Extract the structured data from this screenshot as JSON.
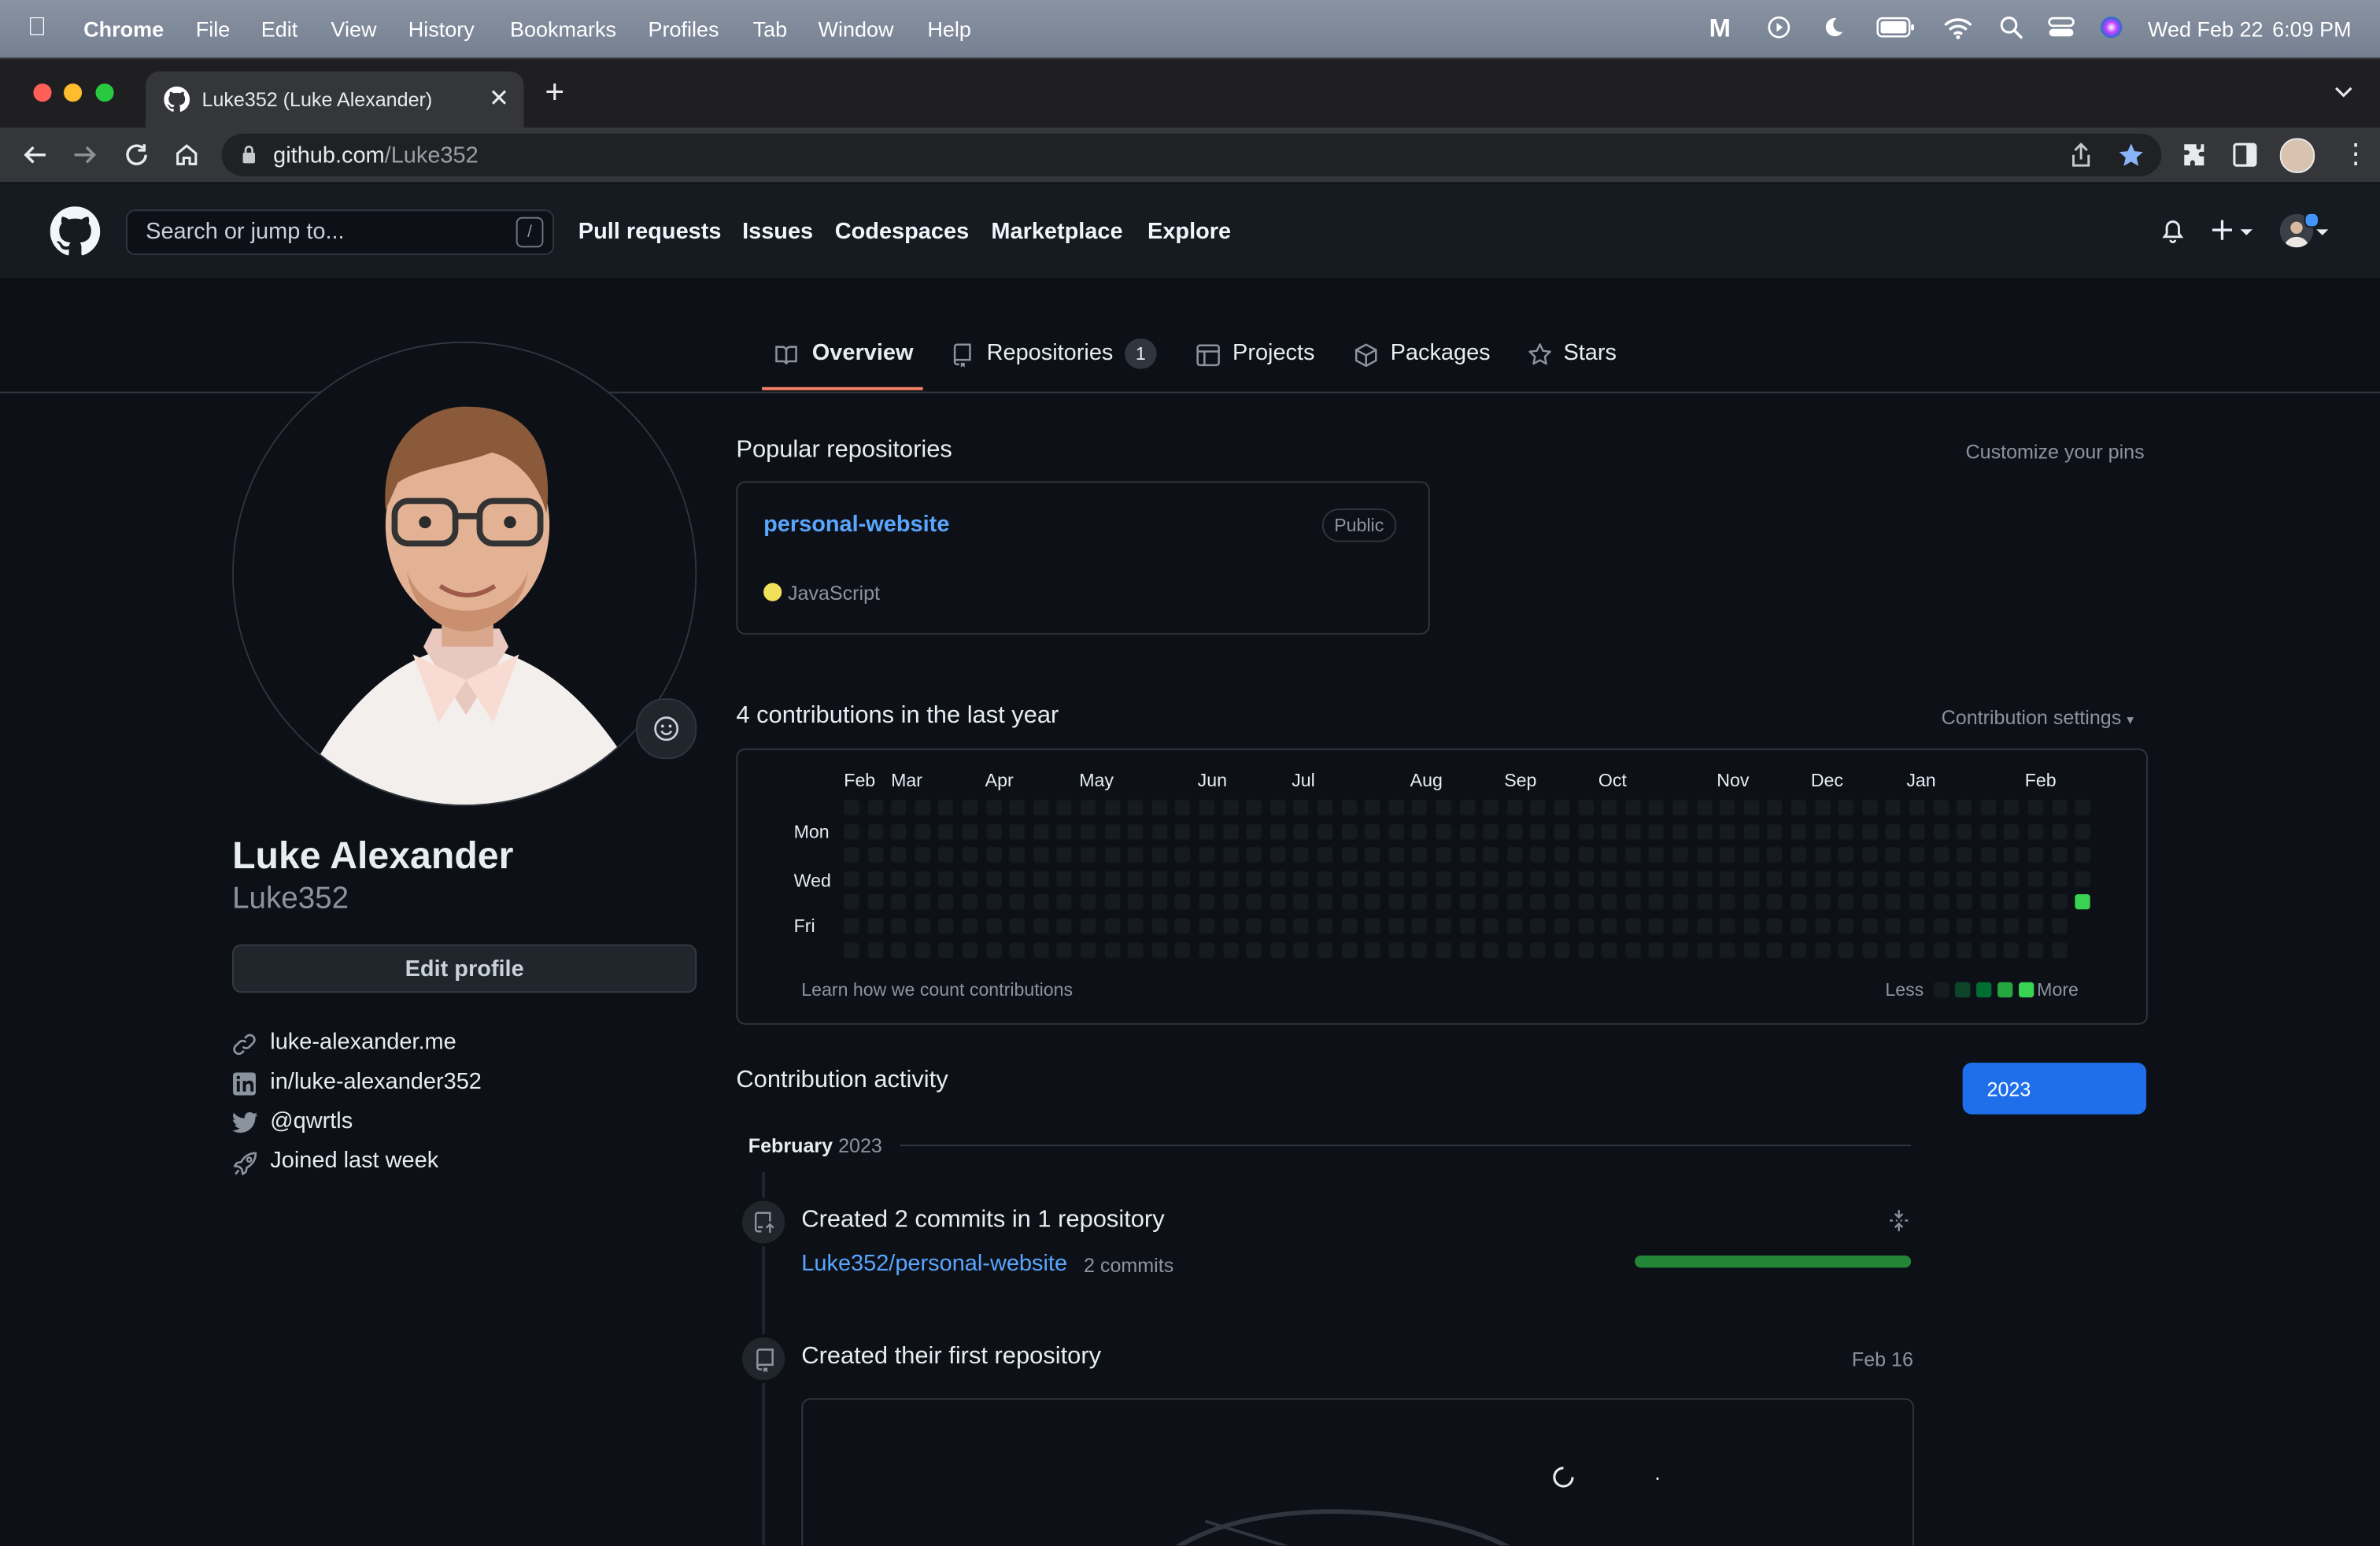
{
  "menubar": {
    "app": "Chrome",
    "items": [
      "File",
      "Edit",
      "View",
      "History",
      "Bookmarks",
      "Profiles",
      "Tab",
      "Window",
      "Help"
    ],
    "date": "Wed Feb 22",
    "time": "6:09 PM"
  },
  "browser": {
    "tab_title": "Luke352 (Luke Alexander)",
    "url_host": "github.com",
    "url_path": "/Luke352"
  },
  "gh_header": {
    "search_placeholder": "Search or jump to...",
    "search_shortcut": "/",
    "nav": [
      "Pull requests",
      "Issues",
      "Codespaces",
      "Marketplace",
      "Explore"
    ]
  },
  "profile_tabs": [
    {
      "label": "Overview",
      "icon": "book-icon",
      "selected": true
    },
    {
      "label": "Repositories",
      "icon": "repo-icon",
      "count": "1"
    },
    {
      "label": "Projects",
      "icon": "table-icon"
    },
    {
      "label": "Packages",
      "icon": "package-icon"
    },
    {
      "label": "Stars",
      "icon": "star-icon"
    }
  ],
  "profile": {
    "name": "Luke Alexander",
    "username": "Luke352",
    "edit_button": "Edit profile",
    "links": [
      {
        "icon": "link-icon",
        "text": "luke-alexander.me"
      },
      {
        "icon": "linkedin-icon",
        "text": "in/luke-alexander352"
      },
      {
        "icon": "twitter-icon",
        "text": "@qwrtls"
      },
      {
        "icon": "rocket-icon",
        "text": "Joined last week"
      }
    ]
  },
  "popular": {
    "heading": "Popular repositories",
    "customize": "Customize your pins",
    "repo": {
      "name": "personal-website",
      "visibility": "Public",
      "language": "JavaScript",
      "language_color": "#f1e05a"
    }
  },
  "contributions": {
    "heading": "4 contributions in the last year",
    "settings": "Contribution settings",
    "months": [
      "Feb",
      "Mar",
      "Apr",
      "May",
      "Jun",
      "Jul",
      "Aug",
      "Sep",
      "Oct",
      "Nov",
      "Dec",
      "Jan",
      "Feb"
    ],
    "days": [
      "Mon",
      "Wed",
      "Fri"
    ],
    "learn": "Learn how we count contributions",
    "less": "Less",
    "more": "More",
    "active_cell": {
      "week": 52,
      "day": 4
    },
    "legend_colors": [
      "#161b22",
      "#0e4429",
      "#006d32",
      "#26a641",
      "#39d353"
    ]
  },
  "activity": {
    "heading": "Contribution activity",
    "year_button": "2023",
    "month": "February",
    "year": "2023",
    "item1": {
      "title": "Created 2 commits in 1 repository",
      "repo": "Luke352/personal-website",
      "commits": "2 commits"
    },
    "item2": {
      "title": "Created their first repository",
      "date": "Feb 16"
    }
  }
}
